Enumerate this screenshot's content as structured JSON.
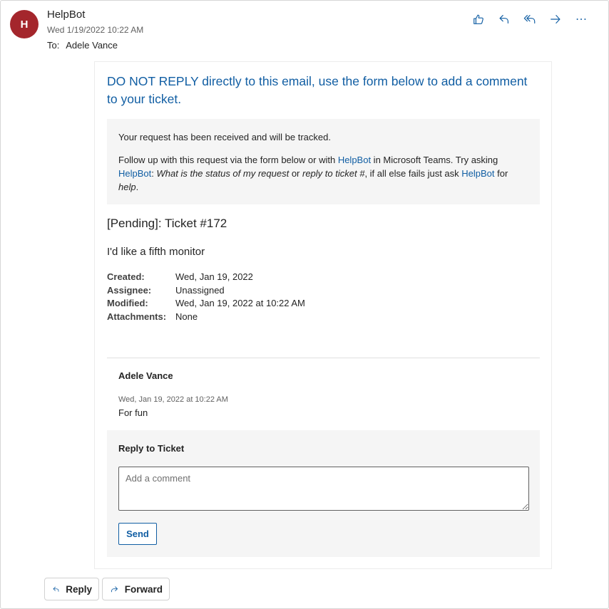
{
  "header": {
    "avatar_initial": "H",
    "avatar_color": "#a4262c",
    "sender": "HelpBot",
    "date": "Wed 1/19/2022 10:22 AM",
    "to_label": "To:",
    "to_name": "Adele Vance",
    "actions": [
      {
        "icon": "thumbs-up-icon"
      },
      {
        "icon": "reply-icon"
      },
      {
        "icon": "reply-all-icon"
      },
      {
        "icon": "forward-icon"
      },
      {
        "icon": "more-icon"
      }
    ]
  },
  "card": {
    "notice": "DO NOT REPLY directly to this email, use the form below to add a comment to your ticket.",
    "info": {
      "received": "Your request has been received and will be tracked.",
      "follow_1": "Follow up with this request via the form below or with ",
      "helpbot": "HelpBot",
      "follow_2": " in Microsoft Teams. Try asking ",
      "colon": ":",
      "status_q": "What is the status of my request",
      "or": " or ",
      "reply_q": "reply to ticket #",
      "fallback": ", if all else fails just ask ",
      "for": "for ",
      "help": "help",
      "period": "."
    },
    "ticket_title": "[Pending]: Ticket #172",
    "ticket_subject": "I'd like a fifth monitor",
    "meta": [
      {
        "key": "Created:",
        "value": "Wed, Jan 19, 2022"
      },
      {
        "key": "Assignee:",
        "value": "Unassigned"
      },
      {
        "key": "Modified:",
        "value": "Wed, Jan 19, 2022 at 10:22 AM"
      },
      {
        "key": "Attachments:",
        "value": "None"
      }
    ],
    "comment": {
      "author": "Adele Vance",
      "date": "Wed, Jan 19, 2022 at 10:22 AM",
      "body": "For fun"
    },
    "reply": {
      "title": "Reply to Ticket",
      "placeholder": "Add a comment",
      "send_label": "Send"
    }
  },
  "footer": {
    "reply_label": "Reply",
    "forward_label": "Forward"
  },
  "colors": {
    "accent": "#115ea3",
    "panel": "#f5f5f5"
  }
}
